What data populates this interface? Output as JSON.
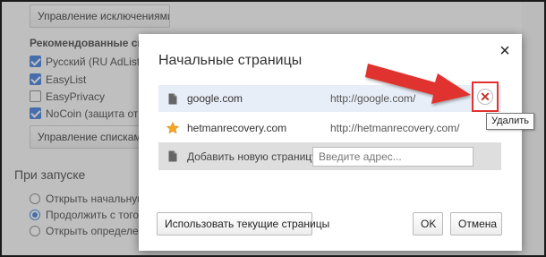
{
  "settings": {
    "exceptions_button": "Управление исключениями...",
    "recommended_title": "Рекомендованные списки",
    "lists": [
      {
        "label": "Русский (RU AdList)",
        "checked": true
      },
      {
        "label": "EasyList",
        "checked": true
      },
      {
        "label": "EasyPrivacy",
        "checked": false
      },
      {
        "label": "NoCoin (защита от майнинга)",
        "checked": true
      }
    ],
    "manage_lists_button": "Управление списками...",
    "startup_title": "При запуске",
    "startup_options": [
      {
        "label": "Открыть начальную страницу",
        "checked": false
      },
      {
        "label": "Продолжить с того же места",
        "checked": true
      },
      {
        "label": "Открыть определенную страницу",
        "checked": false
      }
    ]
  },
  "dialog": {
    "title": "Начальные страницы",
    "pages": [
      {
        "name": "google.com",
        "url": "http://google.com/",
        "icon": "page-icon"
      },
      {
        "name": "hetmanrecovery.com",
        "url": "http://hetmanrecovery.com/",
        "icon": "star-icon"
      }
    ],
    "add_page_label": "Добавить новую страницу",
    "address_placeholder": "Введите адрес...",
    "remove_tooltip": "Удалить",
    "use_current_button": "Использовать текущие страницы",
    "ok_button": "OK",
    "cancel_button": "Отмена"
  },
  "colors": {
    "annotation_red": "#e0332f",
    "checkbox_blue": "#2b6fd6",
    "selected_row": "#e8eef7",
    "star": "#f5a623"
  }
}
